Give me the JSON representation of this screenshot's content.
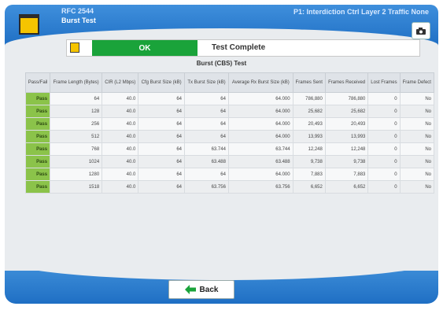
{
  "header": {
    "top_label": "RFC 2544",
    "title": "Burst Test",
    "port_info": "P1: Interdiction Ctrl Layer 2 Traffic None"
  },
  "status": {
    "result": "OK",
    "message": "Test Complete"
  },
  "table": {
    "title": "Burst (CBS) Test",
    "columns": [
      "Pass/Fail",
      "Frame Length (Bytes)",
      "CIR (L2 Mbps)",
      "Cfg Burst Size (kB)",
      "Tx Burst Size (kB)",
      "Average Rx Burst Size (kB)",
      "Frames Sent",
      "Frames Received",
      "Lost Frames",
      "Frame Defect"
    ],
    "rows": [
      [
        "Pass",
        "64",
        "40.0",
        "64",
        "64",
        "64.000",
        "786,880",
        "786,880",
        "0",
        "No"
      ],
      [
        "Pass",
        "128",
        "40.0",
        "64",
        "64",
        "64.000",
        "25,682",
        "25,682",
        "0",
        "No"
      ],
      [
        "Pass",
        "256",
        "40.0",
        "64",
        "64",
        "64.000",
        "20,493",
        "20,493",
        "0",
        "No"
      ],
      [
        "Pass",
        "512",
        "40.0",
        "64",
        "64",
        "64.000",
        "13,993",
        "13,993",
        "0",
        "No"
      ],
      [
        "Pass",
        "768",
        "40.0",
        "64",
        "63.744",
        "63.744",
        "12,248",
        "12,248",
        "0",
        "No"
      ],
      [
        "Pass",
        "1024",
        "40.0",
        "64",
        "63.488",
        "63.488",
        "9,738",
        "9,738",
        "0",
        "No"
      ],
      [
        "Pass",
        "1280",
        "40.0",
        "64",
        "64",
        "64.000",
        "7,883",
        "7,883",
        "0",
        "No"
      ],
      [
        "Pass",
        "1518",
        "40.0",
        "64",
        "63.756",
        "63.756",
        "6,652",
        "6,652",
        "0",
        "No"
      ]
    ]
  },
  "footer": {
    "back_label": "Back"
  },
  "colors": {
    "header_blue": "#1f6fc4",
    "ok_green": "#1aa33a",
    "pass_green": "#8bc34a",
    "icon_yellow": "#f5c400"
  },
  "icons": [
    "app-icon",
    "camera-icon",
    "status-icon",
    "back-arrow-icon"
  ]
}
